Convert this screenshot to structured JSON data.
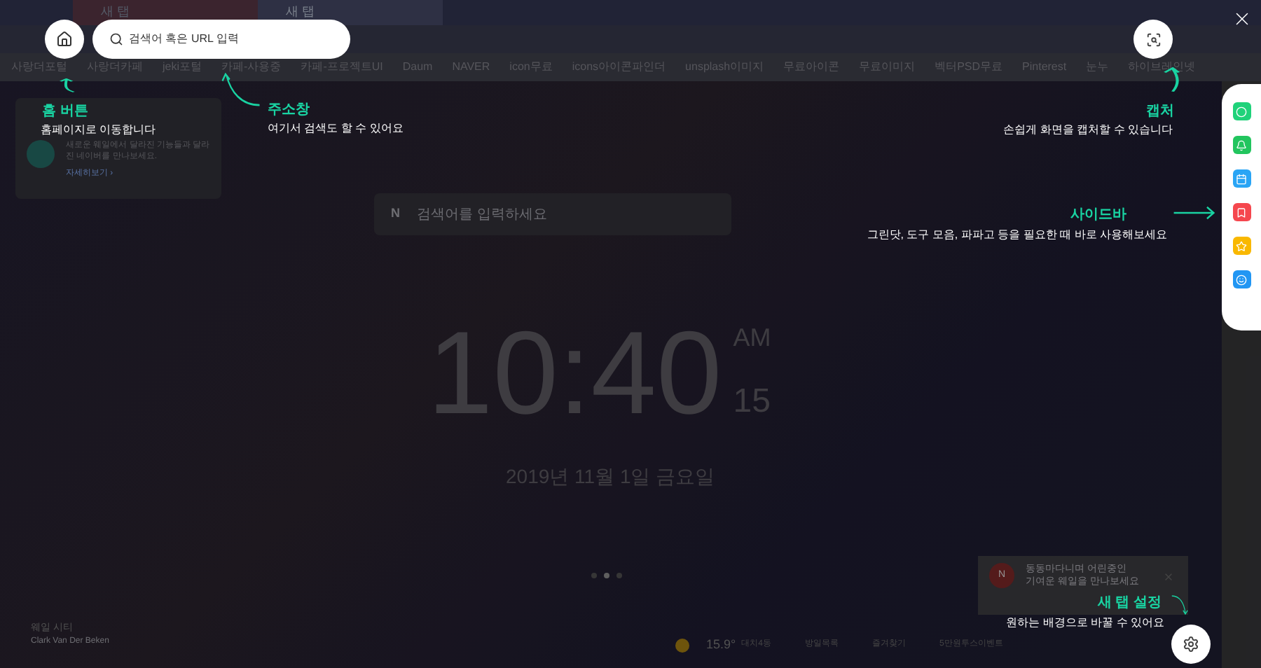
{
  "tabs": [
    {
      "label": "새 탭",
      "selected": false
    },
    {
      "label": "새 탭",
      "selected": true
    }
  ],
  "bookmarks": [
    "사랑더포털",
    "사랑더카페",
    "jeki포털",
    "카페-사용중",
    "카페-프로젝트UI",
    "Daum",
    "NAVER",
    "icon무료",
    "icons아이콘파인더",
    "unsplash이미지",
    "무료아이콘",
    "무료이미지",
    "벡터PSD무료",
    "Pinterest",
    "눈누",
    "하이브레인넷"
  ],
  "notice": {
    "text": "새로운 웨일에서 달라진 기능들과 달라진 네이버를 만나보세요.",
    "link": "자세히보기 ›"
  },
  "page_search": {
    "logo": "N",
    "placeholder": "검색어를 입력하세요"
  },
  "clock": {
    "time": "10:40",
    "ampm": "AM",
    "seconds": "15",
    "date": "2019년 11월 1일 금요일"
  },
  "page_dots": [
    {
      "selected": false
    },
    {
      "selected": true
    },
    {
      "selected": false
    }
  ],
  "photo_credit": {
    "title": "웨일 시티",
    "author": "Clark Van Der Beken"
  },
  "bottom_bar": {
    "temperature": "15.9°",
    "place": "대치4동",
    "links": [
      "방일목록",
      "즐겨찾기",
      "5만원투스이벤트"
    ]
  },
  "news_card": {
    "badge": "N",
    "lines": [
      "동동마다니며 어린중인",
      "기여운 웨일을 만나보세요"
    ]
  },
  "guide": {
    "home_button": {
      "title": "홈 버튼",
      "text": "홈페이지로 이동합니다"
    },
    "address_bar": {
      "placeholder": "검색어 혹은 URL 입력",
      "title": "주소창",
      "text": "여기서 검색도 할 수 있어요"
    },
    "capture": {
      "title": "캡처",
      "text": "손쉽게 화면을 캡처할 수 있습니다"
    },
    "sidebar": {
      "title": "사이드바",
      "text": "그린닷, 도구 모음, 파파고 등을 필요한 때 바로 사용해보세요",
      "items": [
        {
          "color": "#1fd27a"
        },
        {
          "color": "#22c55e"
        },
        {
          "color": "#2aa5f5"
        },
        {
          "color": "#f5474e"
        },
        {
          "color": "#f9b800"
        },
        {
          "color": "#2196f3"
        }
      ]
    },
    "settings": {
      "title": "새 탭 설정",
      "text": "원하는 배경으로 바꿀 수 있어요"
    }
  }
}
